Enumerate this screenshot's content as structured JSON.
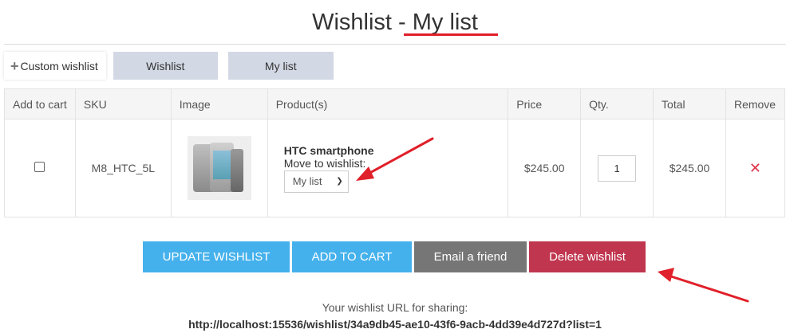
{
  "page": {
    "title_prefix": "Wishlist - ",
    "title_list": "My list"
  },
  "tabs": {
    "custom_label": "Custom wishlist",
    "custom_icon": "plus-icon",
    "wishlist_label": "Wishlist",
    "mylist_label": "My list"
  },
  "table": {
    "headers": [
      "Add to cart",
      "SKU",
      "Image",
      "Product(s)",
      "Price",
      "Qty.",
      "Total",
      "Remove"
    ],
    "row": {
      "sku": "M8_HTC_5L",
      "image_icon": "htc-smartphone-image",
      "product_name": "HTC smartphone",
      "move_label": "Move to wishlist:",
      "move_selected": "My list",
      "price": "$245.00",
      "qty": "1",
      "total": "$245.00",
      "remove_icon": "close-icon"
    }
  },
  "buttons": {
    "update": "UPDATE WISHLIST",
    "add_to_cart": "ADD TO CART",
    "email": "Email a friend",
    "delete": "Delete wishlist"
  },
  "share": {
    "label": "Your wishlist URL for sharing:",
    "url": "http://localhost:15536/wishlist/34a9db45-ae10-43f6-9acb-4dd39e4d727d?list=1"
  },
  "colors": {
    "update_button": "#45b1ec",
    "add_to_cart_button": "#45b1ec",
    "email_button": "#767676",
    "delete_button": "#c0364f",
    "annotation_red": "#e0202a",
    "tab_bg": "#d2d8e4"
  }
}
